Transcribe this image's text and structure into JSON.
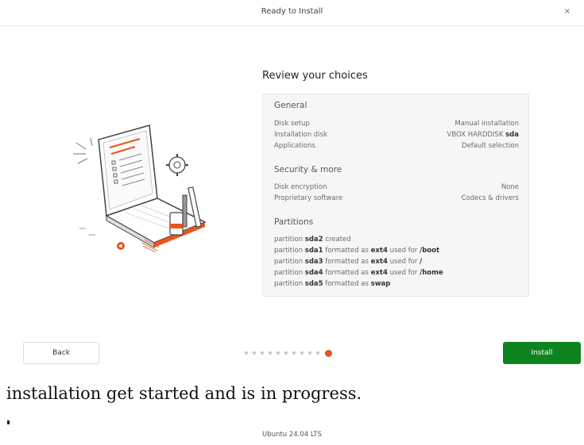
{
  "window": {
    "title": "Ready to Install",
    "close_glyph": "×"
  },
  "main": {
    "heading": "Review your choices",
    "general": {
      "title": "General",
      "rows": [
        {
          "label": "Disk setup",
          "value": "Manual installation"
        },
        {
          "label": "Installation disk",
          "value": "VBOX HARDDISK",
          "value_bold": "sda"
        },
        {
          "label": "Applications",
          "value": "Default selection"
        }
      ]
    },
    "security": {
      "title": "Security & more",
      "rows": [
        {
          "label": "Disk encryption",
          "value": "None"
        },
        {
          "label": "Proprietary software",
          "value": "Codecs & drivers"
        }
      ]
    },
    "partitions": {
      "title": "Partitions",
      "lines": [
        {
          "a": "partition ",
          "b": "sda2",
          "c": " created",
          "d": "",
          "e": "",
          "f": ""
        },
        {
          "a": "partition ",
          "b": "sda1",
          "c": " formatted as ",
          "d": "ext4",
          "e": " used for ",
          "f": "/boot"
        },
        {
          "a": "partition ",
          "b": "sda3",
          "c": " formatted as ",
          "d": "ext4",
          "e": " used for ",
          "f": "/"
        },
        {
          "a": "partition ",
          "b": "sda4",
          "c": " formatted as ",
          "d": "ext4",
          "e": " used for ",
          "f": "/home"
        },
        {
          "a": "partition ",
          "b": "sda5",
          "c": " formatted as ",
          "d": "swap",
          "e": "",
          "f": ""
        }
      ]
    }
  },
  "nav": {
    "back_label": "Back",
    "install_label": "Install",
    "steps_total": 11,
    "current_step": 11
  },
  "caption": "installation get started and is in progress.",
  "footer": "Ubuntu 24.04 LTS",
  "colors": {
    "accent": "#e95420",
    "install": "#0e8420"
  },
  "icons": [
    "close-icon",
    "laptop-illustration"
  ]
}
